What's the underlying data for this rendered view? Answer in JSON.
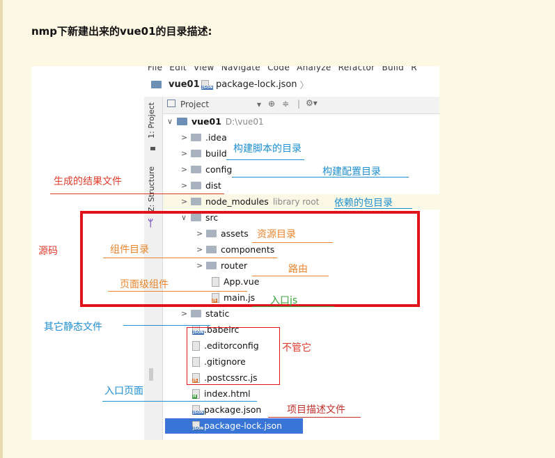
{
  "heading": "nmp下新建出来的vue01的目录描述:",
  "menubar": "File Edit View Navigate Code Analyze Refactor Build R",
  "breadcrumb": {
    "project": "vue01",
    "file": "package-lock.json"
  },
  "side_tabs": {
    "project": "1: Project",
    "structure": "Z: Structure"
  },
  "project_panel": {
    "title": "Project",
    "root_name": "vue01",
    "root_path": "D:\\vue01"
  },
  "tree": [
    {
      "label": ".idea",
      "kind": "folder"
    },
    {
      "label": "build",
      "kind": "folder"
    },
    {
      "label": "config",
      "kind": "folder"
    },
    {
      "label": "dist",
      "kind": "folder"
    },
    {
      "label": "node_modules",
      "kind": "folder",
      "suffix": "library root"
    },
    {
      "label": "src",
      "kind": "folder"
    },
    {
      "label": "assets",
      "kind": "folder"
    },
    {
      "label": "components",
      "kind": "folder"
    },
    {
      "label": "router",
      "kind": "folder"
    },
    {
      "label": "App.vue",
      "kind": "file"
    },
    {
      "label": "main.js",
      "kind": "file",
      "badge": "JS"
    },
    {
      "label": "static",
      "kind": "folder"
    },
    {
      "label": ".babelrc",
      "kind": "file",
      "badge": "JSON"
    },
    {
      "label": ".editorconfig",
      "kind": "file"
    },
    {
      "label": ".gitignore",
      "kind": "file"
    },
    {
      "label": ".postcssrc.js",
      "kind": "file",
      "badge": "JS"
    },
    {
      "label": "index.html",
      "kind": "file",
      "badge": "H"
    },
    {
      "label": "package.json",
      "kind": "file",
      "badge": "JSON"
    },
    {
      "label": "package-lock.json",
      "kind": "file",
      "badge": "JSON"
    }
  ],
  "annotations": {
    "build": "构建脚本的目录",
    "config": "构建配置目录",
    "dist": "生成的结果文件",
    "node_modules": "依赖的包目录",
    "src": "源码",
    "assets": "资源目录",
    "components": "组件目录",
    "router": "路由",
    "app": "页面级组件",
    "main": "入口js",
    "static": "其它静态文件",
    "ignore": "不管它",
    "index": "入口页面",
    "package": "项目描述文件"
  },
  "colors": {
    "blue": "#1e8fd0",
    "red": "#e03a2a",
    "orange": "#e8842a",
    "green": "#3aa63a",
    "darkred": "#c0302a",
    "box": "#e0151b",
    "selection": "#3875d7"
  }
}
